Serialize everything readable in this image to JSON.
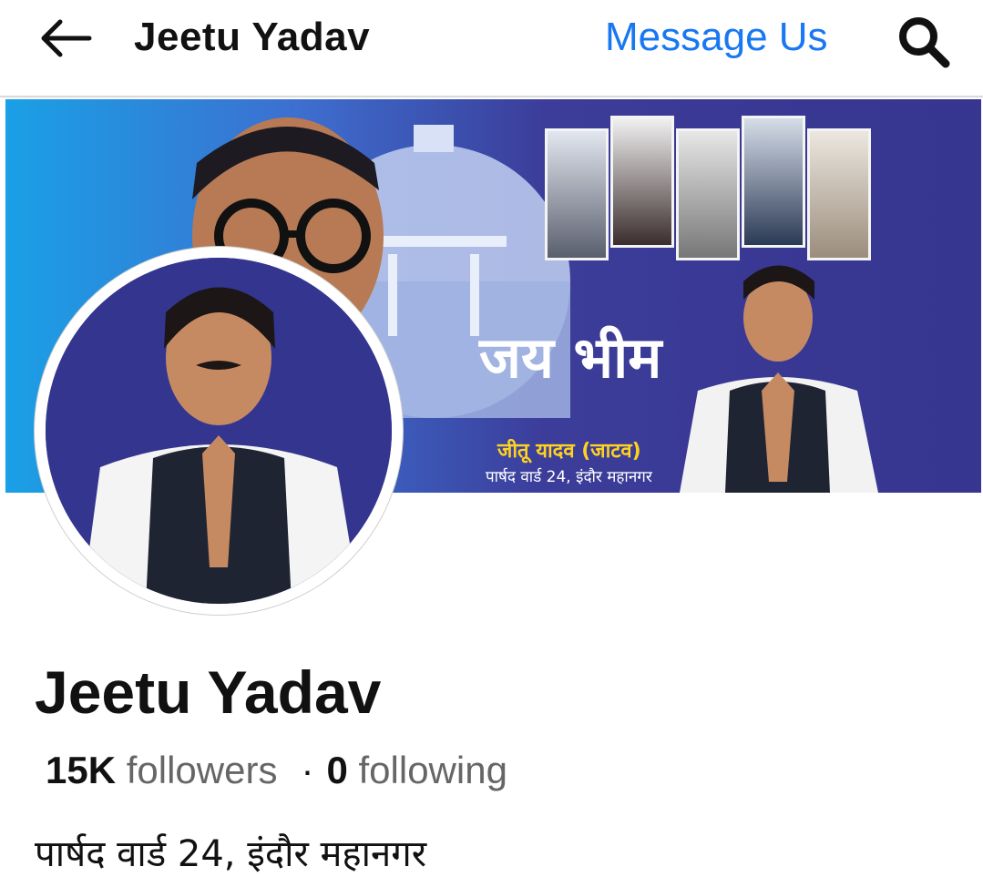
{
  "header": {
    "title": "Jeetu Yadav",
    "message_label": "Message Us",
    "back_icon": "arrow-left-icon",
    "search_icon": "search-icon"
  },
  "cover": {
    "headline": "जय भीम",
    "name_line": "जीतू यादव (जाटव)",
    "sub_line": "पार्षद वार्ड 24, इंदौर महानगर"
  },
  "profile": {
    "name": "Jeetu Yadav",
    "followers_count": "15K",
    "followers_label": "followers",
    "separator": "·",
    "following_count": "0",
    "following_label": "following",
    "bio": "पार्षद वार्ड 24, इंदौर महानगर"
  },
  "colors": {
    "link": "#1877f2",
    "cover_blue": "#36358f"
  }
}
